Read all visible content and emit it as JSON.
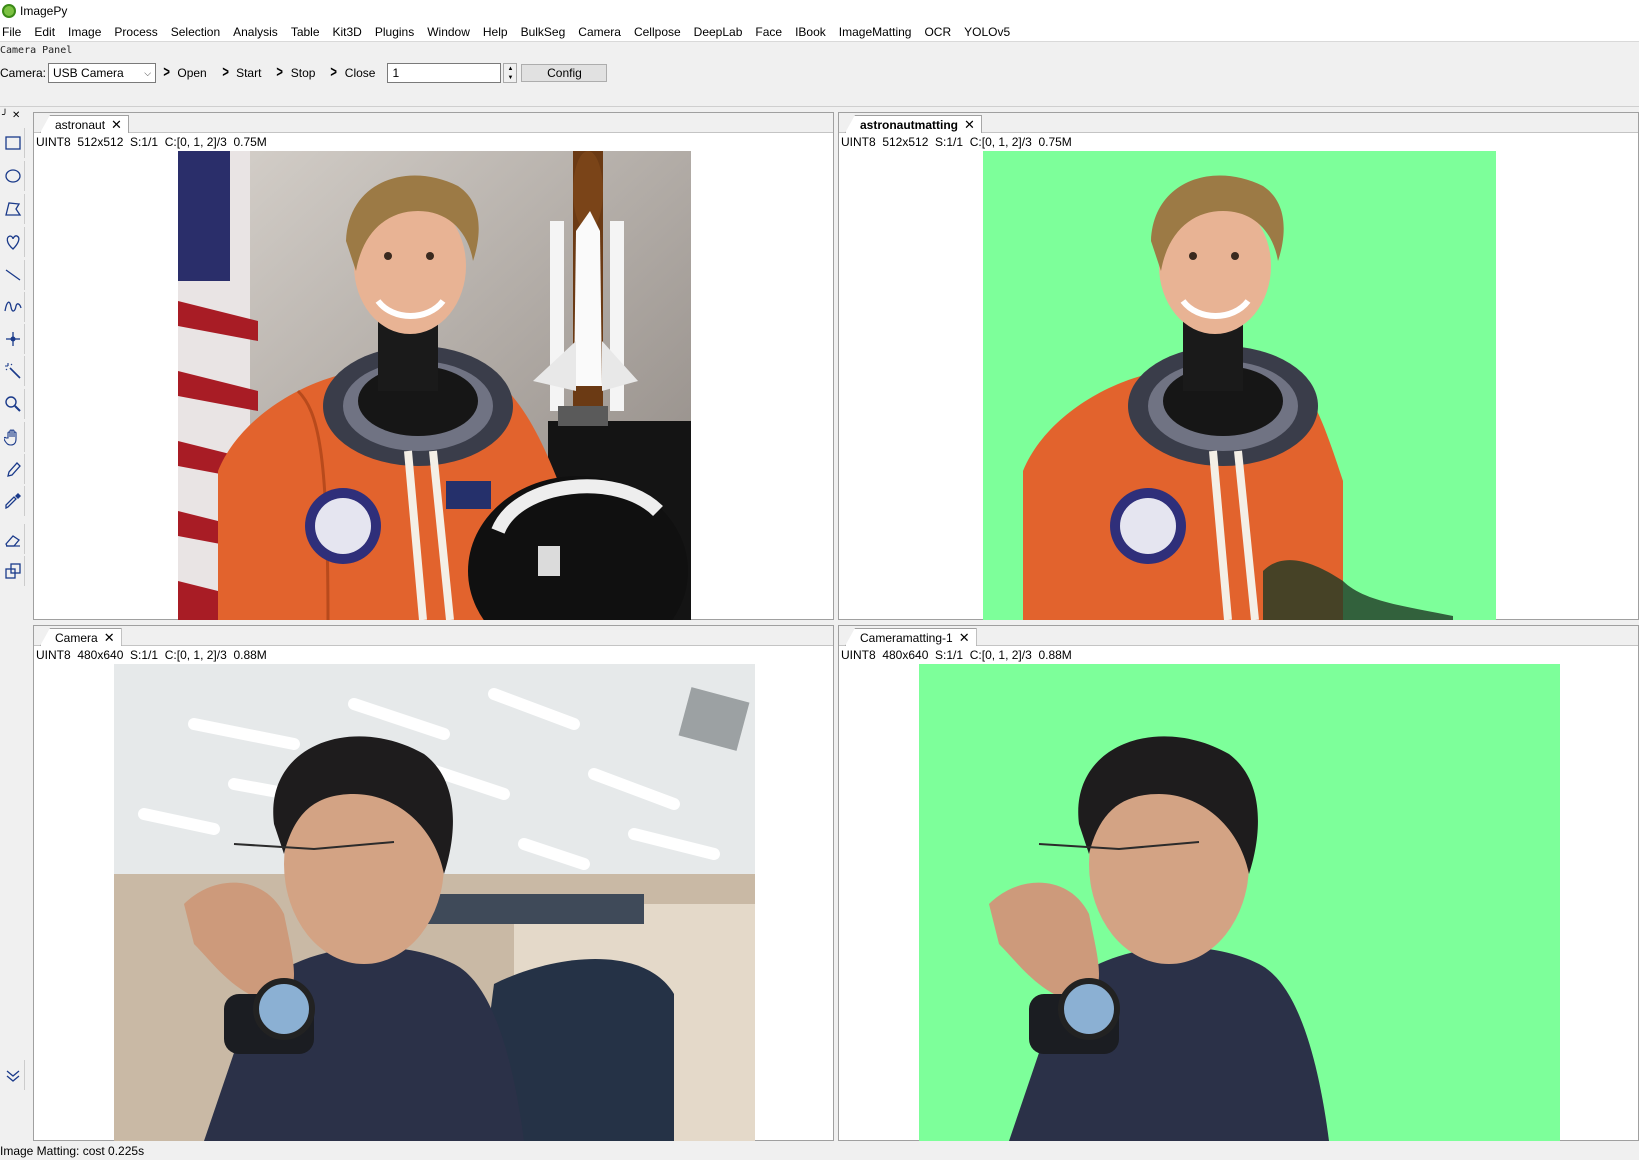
{
  "app": {
    "title": "ImagePy"
  },
  "menu": [
    "File",
    "Edit",
    "Image",
    "Process",
    "Selection",
    "Analysis",
    "Table",
    "Kit3D",
    "Plugins",
    "Window",
    "Help",
    "BulkSeg",
    "Camera",
    "Cellpose",
    "DeepLab",
    "Face",
    "IBook",
    "ImageMatting",
    "OCR",
    "YOLOv5"
  ],
  "camera_panel": {
    "caption": "Camera Panel",
    "camera_label": "Camera:",
    "camera_value": "USB Camera",
    "buttons": {
      "open": "Open",
      "start": "Start",
      "stop": "Stop",
      "close": "Close"
    },
    "number_value": "1",
    "config": "Config"
  },
  "tools": [
    "rectangle-icon",
    "ellipse-icon",
    "polygon-icon",
    "freehand-icon",
    "line-icon",
    "freeline-icon",
    "point-icon",
    "magic-wand-icon",
    "zoom-icon",
    "hand-icon",
    "pencil-icon",
    "picker-icon",
    "eraser-icon",
    "transform-icon",
    "more-icon"
  ],
  "windows": {
    "astronaut": {
      "tab": "astronaut",
      "close": "✕",
      "info": "UINT8  512x512  S:1/1  C:[0, 1, 2]/3  0.75M"
    },
    "astronautmatting": {
      "tab": "astronautmatting",
      "close": "✕",
      "info": "UINT8  512x512  S:1/1  C:[0, 1, 2]/3  0.75M"
    },
    "camera": {
      "tab": "Camera",
      "close": "✕",
      "info": "UINT8  480x640  S:1/1  C:[0, 1, 2]/3  0.88M"
    },
    "cameramatting": {
      "tab": "Cameramatting-1",
      "close": "✕",
      "info": "UINT8  480x640  S:1/1  C:[0, 1, 2]/3  0.88M"
    }
  },
  "matting_background": "#7dff9a",
  "status": "Image Matting: cost 0.225s"
}
